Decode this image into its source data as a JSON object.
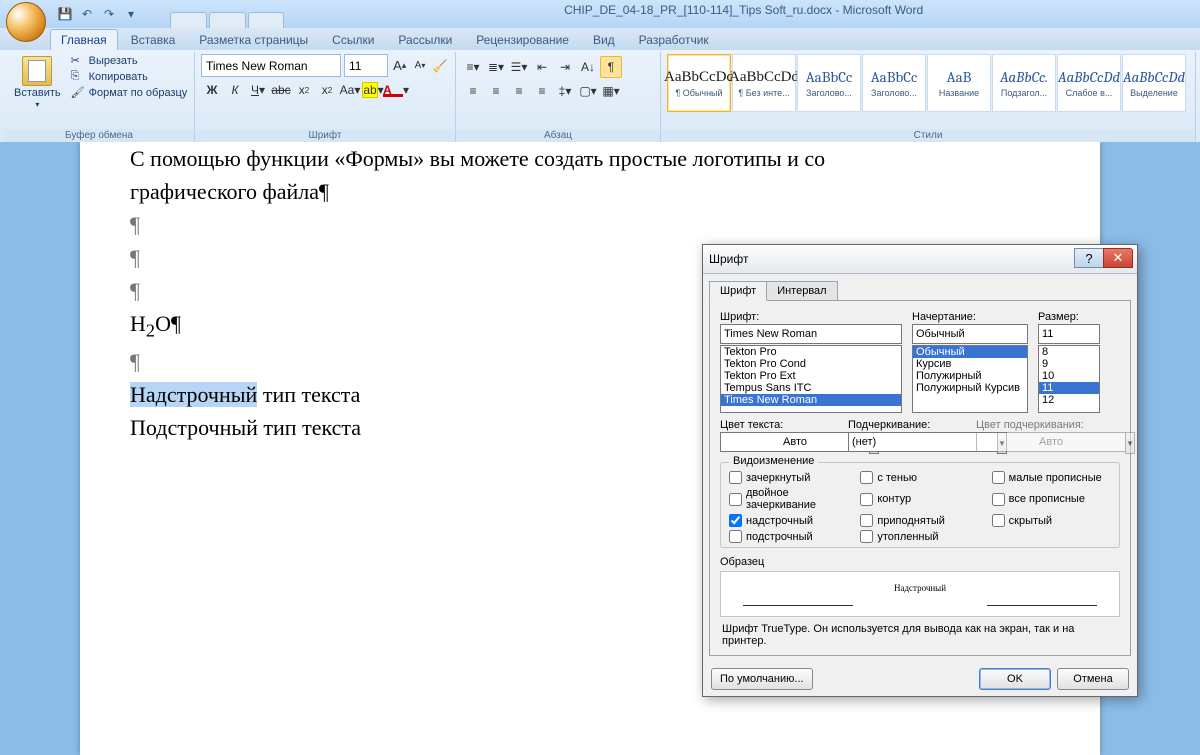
{
  "title": "CHIP_DE_04-18_PR_[110-114]_Tips Soft_ru.docx - Microsoft Word",
  "tabs": {
    "home": "Главная",
    "insert": "Вставка",
    "layout": "Разметка страницы",
    "refs": "Ссылки",
    "mail": "Рассылки",
    "review": "Рецензирование",
    "view": "Вид",
    "dev": "Разработчик"
  },
  "clip": {
    "paste": "Вставить",
    "cut": "Вырезать",
    "copy": "Копировать",
    "format": "Формат по образцу",
    "group": "Буфер обмена"
  },
  "font": {
    "name": "Times New Roman",
    "size": "11",
    "group": "Шрифт"
  },
  "para": {
    "group": "Абзац"
  },
  "styles": {
    "group": "Стили",
    "items": [
      {
        "prev": "AaBbCcDd",
        "label": "¶ Обычный"
      },
      {
        "prev": "AaBbCcDd",
        "label": "¶ Без инте..."
      },
      {
        "prev": "AaBbCc",
        "label": "Заголово...",
        "blue": true
      },
      {
        "prev": "AaBbCc",
        "label": "Заголово...",
        "blue": true
      },
      {
        "prev": "AaB",
        "label": "Название",
        "blue": true
      },
      {
        "prev": "AaBbCc.",
        "label": "Подзагол...",
        "blue": true,
        "ital": true
      },
      {
        "prev": "AaBbCcDd",
        "label": "Слабое в...",
        "blue": true,
        "ital": true
      },
      {
        "prev": "AaBbCcDd",
        "label": "Выделение",
        "blue": true,
        "ital": true
      }
    ]
  },
  "doc": {
    "l1": "С помощью функции «Формы» вы можете создать простые логотипы и со",
    "l2": "графического файла¶",
    "l3": "H",
    "l3sub": "2",
    "l3b": "O¶",
    "l4": "Надстрочный",
    "l4b": " тип текста",
    "l5": "Подстрочный тип текста"
  },
  "dlg": {
    "title": "Шрифт",
    "tab1": "Шрифт",
    "tab2": "Интервал",
    "lbl_font": "Шрифт:",
    "lbl_style": "Начертание:",
    "lbl_size": "Размер:",
    "font_val": "Times New Roman",
    "font_list": [
      "Tekton Pro",
      "Tekton Pro Cond",
      "Tekton Pro Ext",
      "Tempus Sans ITC",
      "Times New Roman"
    ],
    "style_val": "Обычный",
    "style_list": [
      "Обычный",
      "Курсив",
      "Полужирный",
      "Полужирный Курсив"
    ],
    "size_val": "11",
    "size_list": [
      "8",
      "9",
      "10",
      "11",
      "12"
    ],
    "lbl_color": "Цвет текста:",
    "color_val": "Авто",
    "lbl_under": "Подчеркивание:",
    "under_val": "(нет)",
    "lbl_ucolor": "Цвет подчеркивания:",
    "ucolor_val": "Авто",
    "grp_eff": "Видоизменение",
    "chk": {
      "strike": "зачеркнутый",
      "dstrike": "двойное зачеркивание",
      "sup": "надстрочный",
      "sub": "подстрочный",
      "shadow": "с тенью",
      "outline": "контур",
      "emboss": "приподнятый",
      "engrave": "утопленный",
      "scaps": "малые прописные",
      "caps": "все прописные",
      "hidden": "скрытый"
    },
    "lbl_sample": "Образец",
    "sample_text": "Надстрочный",
    "hint": "Шрифт TrueType. Он используется для вывода как на экран, так и на принтер.",
    "btn_def": "По умолчанию...",
    "btn_ok": "OK",
    "btn_cancel": "Отмена"
  }
}
